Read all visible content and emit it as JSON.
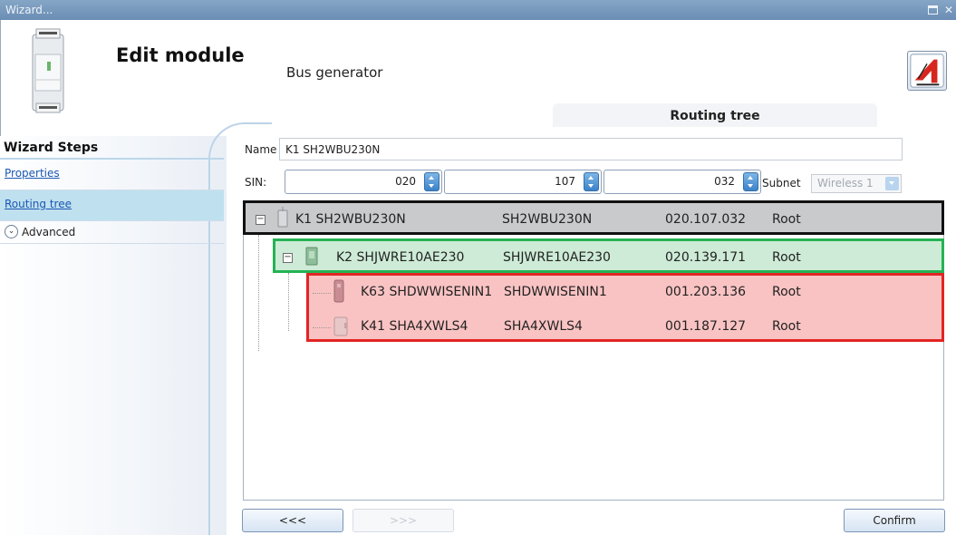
{
  "window": {
    "title": "Wizard..."
  },
  "header": {
    "title": "Edit module",
    "subtitle": "Bus generator"
  },
  "section_tab": "Routing tree",
  "sidebar": {
    "title": "Wizard Steps",
    "steps": [
      {
        "label": "Properties",
        "active": false
      },
      {
        "label": "Routing tree",
        "active": true
      }
    ],
    "advanced_label": "Advanced"
  },
  "form": {
    "name_label": "Name",
    "name_value": "K1 SH2WBU230N",
    "sin_label": "SIN:",
    "sin_values": [
      "020",
      "107",
      "032"
    ],
    "subnet_label": "Subnet",
    "subnet_value": "Wireless 1"
  },
  "tree": {
    "rows": [
      {
        "name": "K1 SH2WBU230N",
        "model": "SH2WBU230N",
        "address": "020.107.032",
        "route": "Root"
      },
      {
        "name": "K2 SHJWRE10AE230",
        "model": "SHJWRE10AE230",
        "address": "020.139.171",
        "route": "Root"
      },
      {
        "name": "K63 SHDWWISENIN1",
        "model": "SHDWWISENIN1",
        "address": "001.203.136",
        "route": "Root"
      },
      {
        "name": "K41 SHA4XWLS4",
        "model": "SHA4XWLS4",
        "address": "001.187.127",
        "route": "Root"
      }
    ],
    "highlight_colors": {
      "root": "#111111",
      "router": "#25b354",
      "endpoints": "#e22424"
    }
  },
  "footer": {
    "back_label": "<<<",
    "next_label": ">>>",
    "confirm_label": "Confirm"
  }
}
